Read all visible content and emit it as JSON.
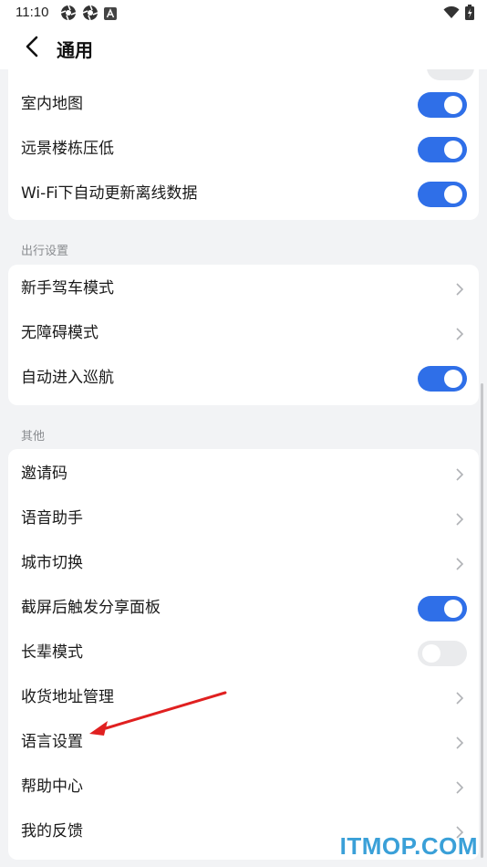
{
  "status_bar": {
    "time": "11:10",
    "left_icons": [
      "aperture-icon",
      "aperture-icon",
      "a-icon"
    ],
    "right_icons": [
      "wifi-icon",
      "battery-icon"
    ]
  },
  "header": {
    "title": "通用",
    "back_icon": "chevron-left-icon"
  },
  "accent_color": "#2f6fe8",
  "sections": {
    "map": {
      "items": [
        {
          "label": "室内地图",
          "control": "toggle",
          "on": true
        },
        {
          "label": "远景楼栋压低",
          "control": "toggle",
          "on": true
        },
        {
          "label": "Wi-Fi下自动更新离线数据",
          "control": "toggle",
          "on": true
        }
      ]
    },
    "travel": {
      "title": "出行设置",
      "items": [
        {
          "label": "新手驾车模式",
          "control": "chevron"
        },
        {
          "label": "无障碍模式",
          "control": "chevron"
        },
        {
          "label": "自动进入巡航",
          "control": "toggle",
          "on": true
        }
      ]
    },
    "other": {
      "title": "其他",
      "items": [
        {
          "label": "邀请码",
          "control": "chevron"
        },
        {
          "label": "语音助手",
          "control": "chevron"
        },
        {
          "label": "城市切换",
          "control": "chevron"
        },
        {
          "label": "截屏后触发分享面板",
          "control": "toggle",
          "on": true
        },
        {
          "label": "长辈模式",
          "control": "toggle",
          "on": false
        },
        {
          "label": "收货地址管理",
          "control": "chevron"
        },
        {
          "label": "语言设置",
          "control": "chevron"
        },
        {
          "label": "帮助中心",
          "control": "chevron"
        },
        {
          "label": "我的反馈",
          "control": "chevron"
        }
      ]
    }
  },
  "annotation": {
    "type": "red-arrow",
    "color": "#e02020",
    "points_to": "语言设置"
  },
  "watermark": "ITMOP.COM"
}
